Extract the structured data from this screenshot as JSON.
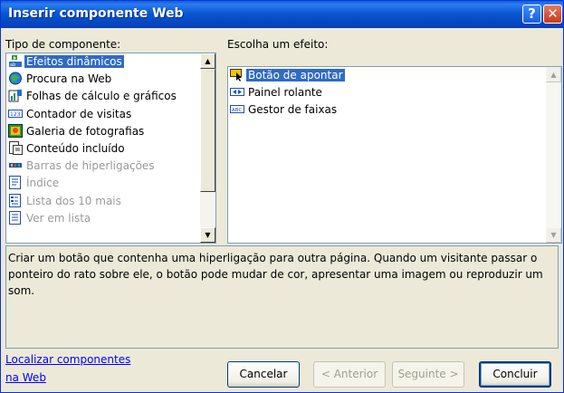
{
  "window": {
    "title": "Inserir componente Web"
  },
  "titlebar": {
    "help_symbol": "?",
    "close_symbol": "✕"
  },
  "left_panel": {
    "label": "Tipo de componente:",
    "items": [
      {
        "label": "Efeitos dinâmicos",
        "icon": "dynamic-effects-icon",
        "selected": true,
        "disabled": false
      },
      {
        "label": "Procura na Web",
        "icon": "web-search-icon",
        "selected": false,
        "disabled": false
      },
      {
        "label": "Folhas de cálculo e gráficos",
        "icon": "spreadsheet-chart-icon",
        "selected": false,
        "disabled": false
      },
      {
        "label": "Contador de visitas",
        "icon": "hit-counter-icon",
        "selected": false,
        "disabled": false
      },
      {
        "label": "Galeria de fotografias",
        "icon": "photo-gallery-icon",
        "selected": false,
        "disabled": false
      },
      {
        "label": "Conteúdo incluído",
        "icon": "included-content-icon",
        "selected": false,
        "disabled": false
      },
      {
        "label": "Barras de hiperligações",
        "icon": "link-bar-icon",
        "selected": false,
        "disabled": true
      },
      {
        "label": "Índice",
        "icon": "index-icon",
        "selected": false,
        "disabled": true
      },
      {
        "label": "Lista dos 10 mais",
        "icon": "top-ten-list-icon",
        "selected": false,
        "disabled": true
      },
      {
        "label": "Ver em lista",
        "icon": "list-view-icon",
        "selected": false,
        "disabled": true
      }
    ]
  },
  "right_panel": {
    "label": "Escolha um efeito:",
    "items": [
      {
        "label": "Botão de apontar",
        "icon": "hover-button-icon",
        "selected": true
      },
      {
        "label": "Painel rolante",
        "icon": "marquee-icon",
        "selected": false
      },
      {
        "label": "Gestor de faixas",
        "icon": "banner-ad-manager-icon",
        "selected": false
      }
    ]
  },
  "description": "Criar um botão que contenha uma hiperligação para outra página. Quando um visitante passar o ponteiro do rato sobre ele, o botão pode mudar de cor, apresentar uma imagem ou reproduzir um som.",
  "footer": {
    "link_line1": "Localizar componentes",
    "link_line2": "na Web",
    "cancel": "Cancelar",
    "back": "< Anterior",
    "next": "Seguinte >",
    "finish": "Concluir"
  },
  "colors": {
    "selection": "#316ac5",
    "titlebar": "#0a58d0",
    "dialog": "#ece9d8"
  }
}
